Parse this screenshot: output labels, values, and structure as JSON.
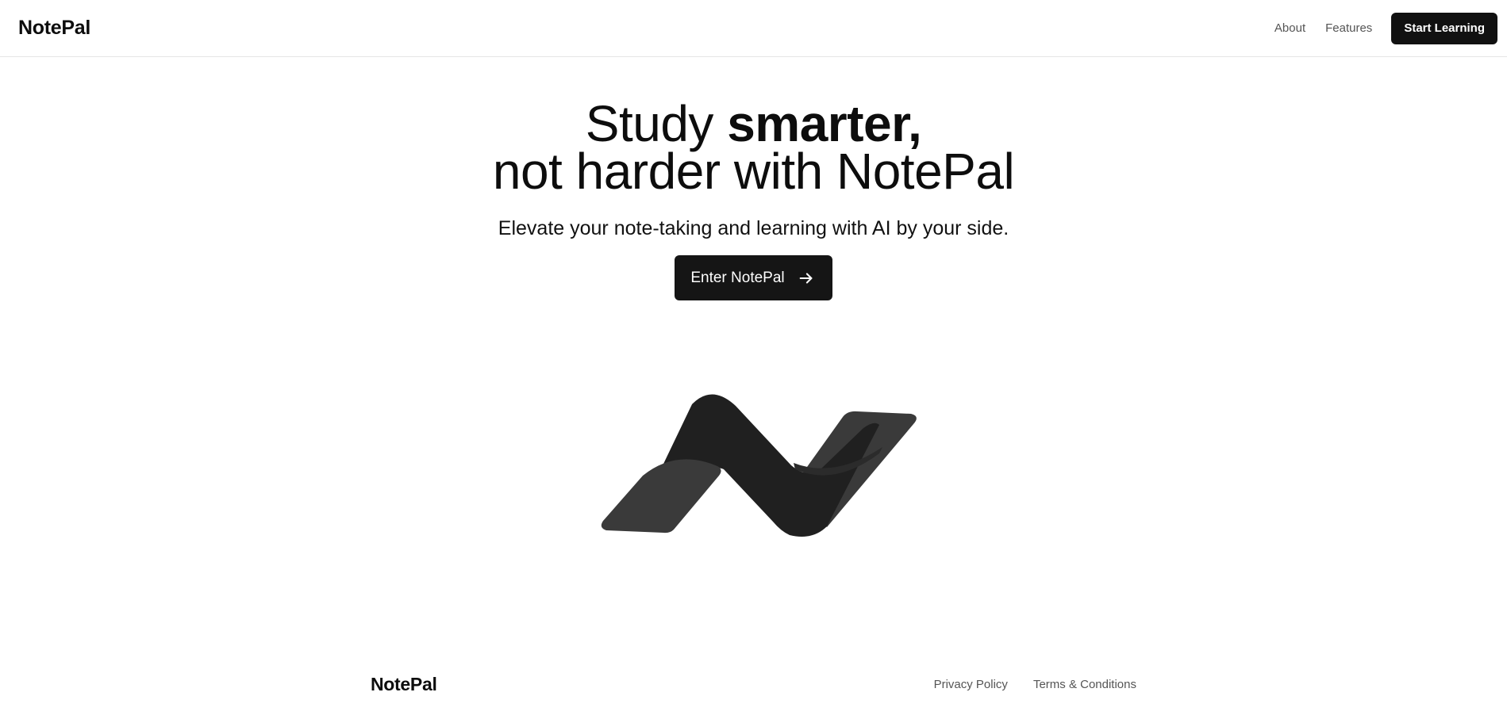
{
  "header": {
    "brand": "NotePal",
    "nav": {
      "about": "About",
      "features": "Features",
      "cta": "Start Learning"
    }
  },
  "hero": {
    "title_line1_normal": "Study ",
    "title_line1_bold": "smarter,",
    "title_line2": "not harder with NotePal",
    "subtitle": "Elevate your note-taking and learning with AI by your side.",
    "button_label": "Enter NotePal",
    "button_icon": "arrow-right-icon"
  },
  "graphic": {
    "icon": "notepal-logo-icon",
    "colors": {
      "dark": "#1f1f1f",
      "light": "#3a3a3a"
    }
  },
  "footer": {
    "brand": "NotePal",
    "links": {
      "privacy": "Privacy Policy",
      "terms": "Terms & Conditions"
    }
  },
  "theme": {
    "primary": "#111111",
    "background": "#ffffff",
    "muted_text": "#555555",
    "border": "#e5e5e5"
  }
}
